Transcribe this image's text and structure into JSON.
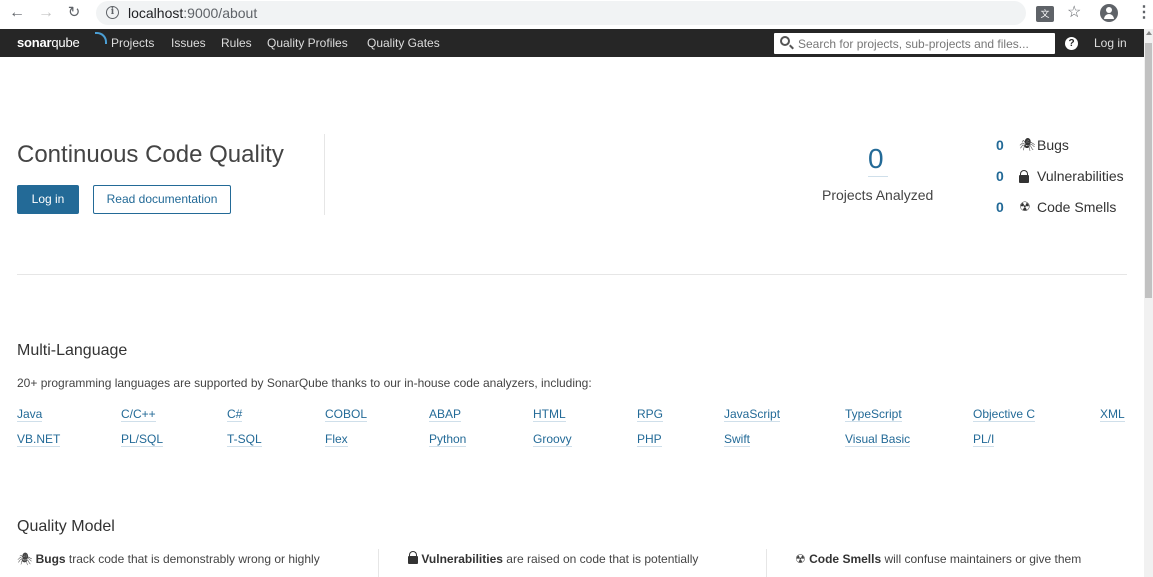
{
  "browser": {
    "url_host": "localhost",
    "url_path": ":9000/about",
    "back_icon": "arrow-left-icon",
    "forward_icon": "arrow-right-icon",
    "reload_icon": "reload-icon",
    "star_icon": "star-icon",
    "menu_icon": "vertical-dots-icon"
  },
  "navbar": {
    "logo_bold": "sonar",
    "logo_light": "qube",
    "menu": [
      "Projects",
      "Issues",
      "Rules",
      "Quality Profiles",
      "Quality Gates"
    ],
    "search_placeholder": "Search for projects, sub-projects and files...",
    "help_label": "?",
    "login_label": "Log in"
  },
  "hero": {
    "title": "Continuous Code Quality",
    "login_button": "Log in",
    "docs_button": "Read documentation",
    "projects_count": "0",
    "projects_label": "Projects Analyzed",
    "stats": [
      {
        "count": "0",
        "icon": "bug-icon",
        "label": "Bugs"
      },
      {
        "count": "0",
        "icon": "lock-icon",
        "label": "Vulnerabilities"
      },
      {
        "count": "0",
        "icon": "code-smell-icon",
        "label": "Code Smells"
      }
    ]
  },
  "languages": {
    "title": "Multi-Language",
    "description": "20+ programming languages are supported by SonarQube thanks to our in-house code analyzers, including:",
    "row1": [
      "Java",
      "C/C++",
      "C#",
      "COBOL",
      "ABAP",
      "HTML",
      "RPG",
      "JavaScript",
      "TypeScript",
      "Objective C",
      "XML"
    ],
    "row2": [
      "VB.NET",
      "PL/SQL",
      "T-SQL",
      "Flex",
      "Python",
      "Groovy",
      "PHP",
      "Swift",
      "Visual Basic",
      "PL/I"
    ]
  },
  "quality_model": {
    "title": "Quality Model",
    "columns": [
      {
        "icon": "bug-icon",
        "bold": "Bugs",
        "text": " track code that is demonstrably wrong or highly"
      },
      {
        "icon": "lock-icon",
        "bold": "Vulnerabilities",
        "text": " are raised on code that is potentially"
      },
      {
        "icon": "code-smell-icon",
        "bold": "Code Smells",
        "text": " will confuse maintainers or give them"
      }
    ]
  }
}
